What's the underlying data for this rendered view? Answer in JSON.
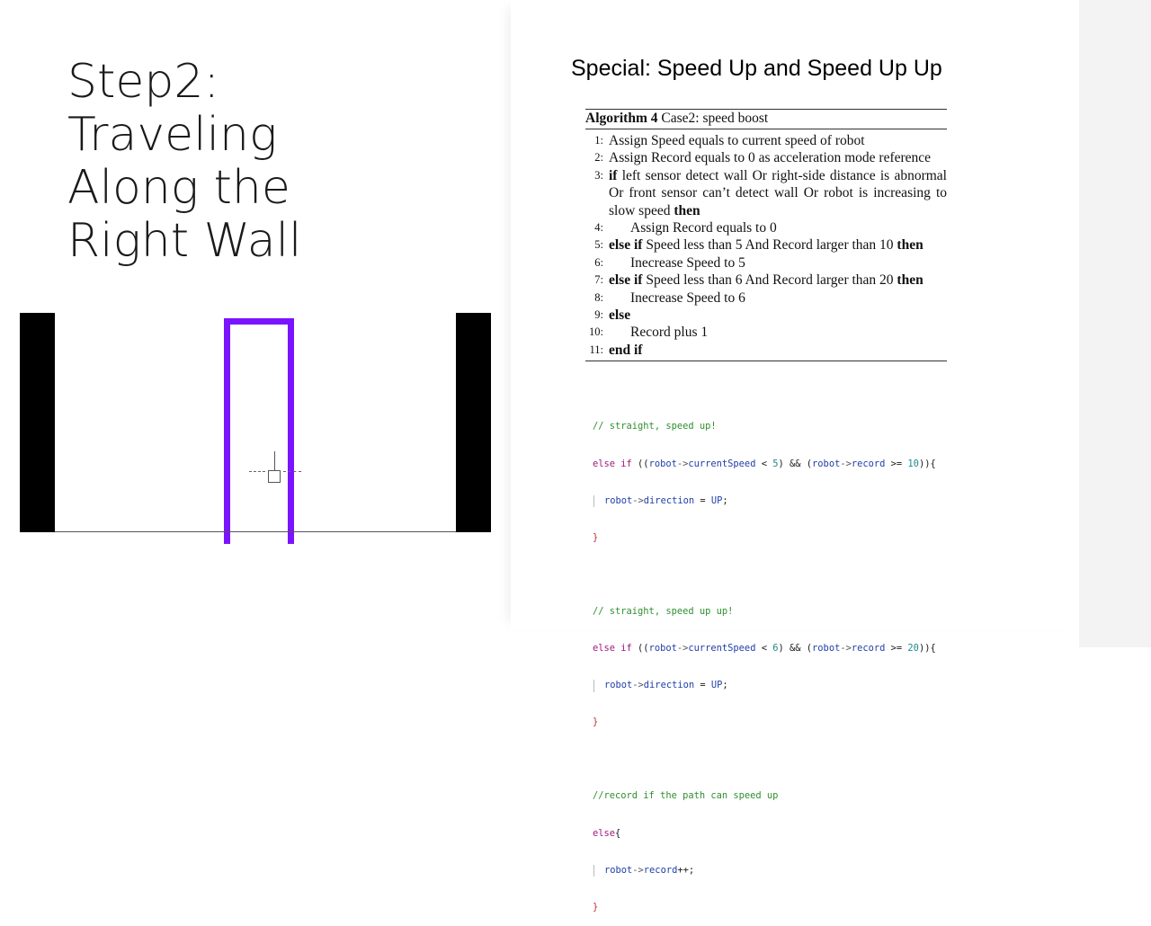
{
  "slide": {
    "title_lines": [
      "Step2:",
      "Traveling",
      "Along the",
      "Right Wall"
    ],
    "subtitle": "Special: Speed Up and Speed Up Up"
  },
  "colors": {
    "path": "#7a14ff",
    "walls": "#000000",
    "gutter": "#f3f3f3"
  },
  "algorithm": {
    "label": "Algorithm 4",
    "caption": "Case2: speed boost",
    "lines": [
      {
        "n": "1:",
        "parts": [
          {
            "t": "Assign Speed equals to current speed of robot"
          }
        ]
      },
      {
        "n": "2:",
        "parts": [
          {
            "t": "Assign Record equals to 0 as acceleration mode reference"
          }
        ]
      },
      {
        "n": "3:",
        "parts": [
          {
            "t": "if",
            "b": true
          },
          {
            "t": " left sensor detect wall Or right-side distance is abnormal Or front sensor can’t detect wall Or robot is increasing to slow speed "
          },
          {
            "t": "then",
            "b": true
          }
        ]
      },
      {
        "n": "4:",
        "indent": true,
        "parts": [
          {
            "t": "Assign Record equals to 0"
          }
        ]
      },
      {
        "n": "5:",
        "parts": [
          {
            "t": "else if",
            "b": true
          },
          {
            "t": " Speed less than 5 And Record larger than 10 "
          },
          {
            "t": "then",
            "b": true
          }
        ]
      },
      {
        "n": "6:",
        "indent": true,
        "parts": [
          {
            "t": "Inecrease Speed to 5"
          }
        ]
      },
      {
        "n": "7:",
        "parts": [
          {
            "t": "else if",
            "b": true
          },
          {
            "t": " Speed less than 6 And Record larger than 20 "
          },
          {
            "t": "then",
            "b": true
          }
        ]
      },
      {
        "n": "8:",
        "indent": true,
        "parts": [
          {
            "t": "Inecrease Speed to 6"
          }
        ]
      },
      {
        "n": "9:",
        "parts": [
          {
            "t": "else",
            "b": true
          }
        ]
      },
      {
        "n": "10:",
        "indent": true,
        "parts": [
          {
            "t": "Record plus 1"
          }
        ]
      },
      {
        "n": "11:",
        "parts": [
          {
            "t": "end if",
            "b": true
          }
        ]
      }
    ]
  },
  "code": {
    "comment1": "// straight, speed up!",
    "comment2": "// straight, speed up up!",
    "comment3": "//record if the path can speed up",
    "else_if": "else if",
    "else_kw": "else",
    "robot": "robot",
    "arrow": "->",
    "currentSpeed": "currentSpeed",
    "record_field": "record",
    "direction": "direction",
    "up": "UP",
    "n5": "5",
    "n6": "6",
    "n10": "10",
    "n20": "20"
  }
}
